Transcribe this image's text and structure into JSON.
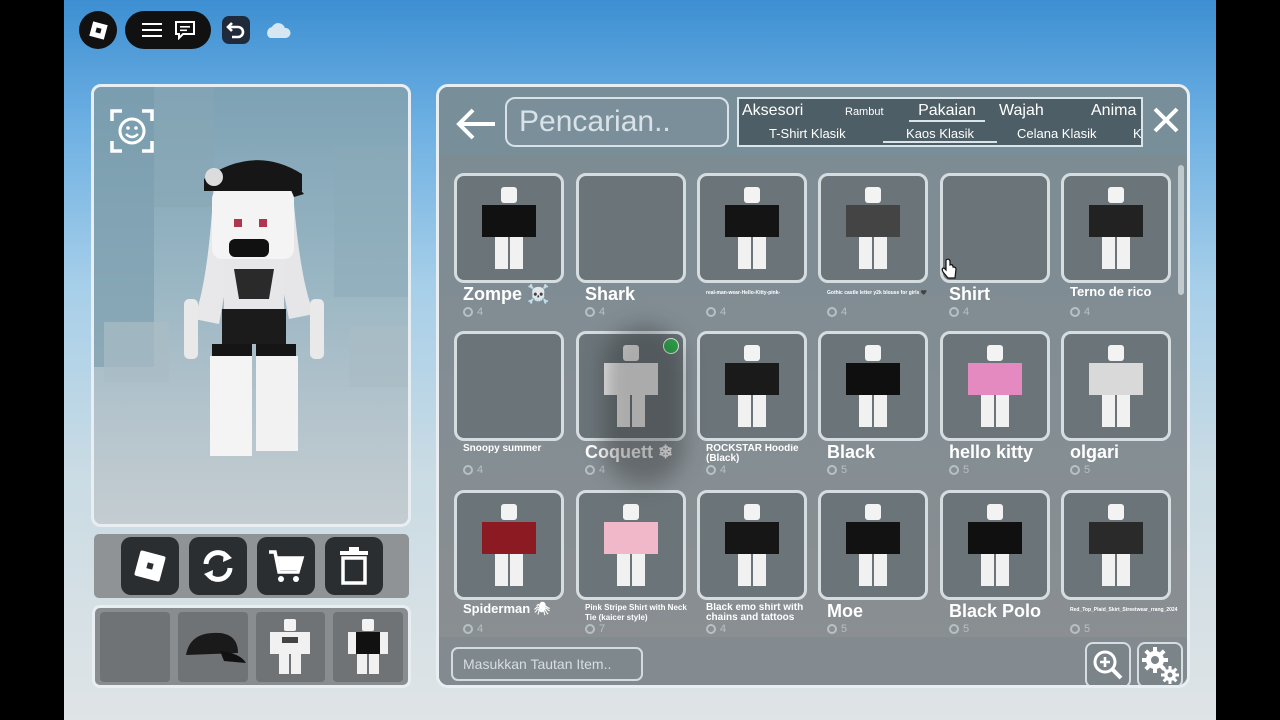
{
  "topbar": {
    "roblox_icon": "roblox-logo-icon",
    "menu_icon": "hamburger-icon",
    "chat_icon": "chat-icon",
    "undo_icon": "undo-icon",
    "cloud_icon": "cloud-sync-icon"
  },
  "preview": {
    "emote_icon": "face-scan-icon"
  },
  "actions": {
    "buttons": [
      "roblox-icon",
      "refresh-icon",
      "cart-icon",
      "trash-icon"
    ]
  },
  "equipped": {
    "slots": [
      "empty",
      "cap",
      "shirt-white",
      "shirt-black"
    ]
  },
  "catalog": {
    "search_placeholder": "Pencarian..",
    "tabs_top": {
      "t1": "Aksesori",
      "t2": "Rambut",
      "t3": "Pakaian",
      "t4": "Wajah",
      "t5": "Anima"
    },
    "tabs_bottom": {
      "t1": "T-Shirt Klasik",
      "t2": "Kaos Klasik",
      "t3": "Celana Klasik",
      "t4": "K"
    },
    "url_placeholder": "Masukkan Tautan Item..",
    "items": [
      {
        "name": "Zompe ☠️",
        "price": "4",
        "size": "big",
        "shirt": "#111111"
      },
      {
        "name": "Shark",
        "price": "4",
        "size": "big",
        "shirt": ""
      },
      {
        "name": "real-man-wear-Hello-Kitty-pink-",
        "price": "4",
        "size": "tiny",
        "shirt": "#141414"
      },
      {
        "name": "Gothic castle letter y2k blouse for girls 🖤",
        "price": "4",
        "size": "tiny",
        "shirt": "#444444"
      },
      {
        "name": "Shirt",
        "price": "4",
        "size": "big",
        "shirt": ""
      },
      {
        "name": "Terno de rico",
        "price": "4",
        "size": "medium",
        "shirt": "#222222"
      },
      {
        "name": "Snoopy summer",
        "price": "4",
        "size": "small",
        "shirt": ""
      },
      {
        "name": "Coquett ❄",
        "price": "4",
        "size": "big",
        "shirt": "#f1f1f1"
      },
      {
        "name": "ROCKSTAR Hoodie (Black)",
        "price": "4",
        "size": "small",
        "shirt": "#1a1a1a"
      },
      {
        "name": "Black",
        "price": "5",
        "size": "big",
        "shirt": "#0f0f0f"
      },
      {
        "name": "hello kitty",
        "price": "5",
        "size": "big",
        "shirt": "#e58ac0"
      },
      {
        "name": "olgari",
        "price": "5",
        "size": "big",
        "shirt": "#d9d9d9"
      },
      {
        "name": "Spiderman 🕷",
        "price": "4",
        "size": "medium",
        "shirt": "#8b1a22"
      },
      {
        "name": "Pink Stripe Shirt with Neck Tie (kaicer style)",
        "price": "7",
        "size": "tiny2",
        "shirt": "#f0b8c8"
      },
      {
        "name": "Black emo shirt with chains and tattoos",
        "price": "4",
        "size": "small",
        "shirt": "#161616"
      },
      {
        "name": "Moe",
        "price": "5",
        "size": "big",
        "shirt": "#121212"
      },
      {
        "name": "Black Polo",
        "price": "5",
        "size": "big",
        "shirt": "#101010"
      },
      {
        "name": "Red_Top_Plaid_Skirt_Streetwear_rrang_2024",
        "price": "5",
        "size": "tiny",
        "shirt": "#2a2a2a"
      }
    ]
  }
}
